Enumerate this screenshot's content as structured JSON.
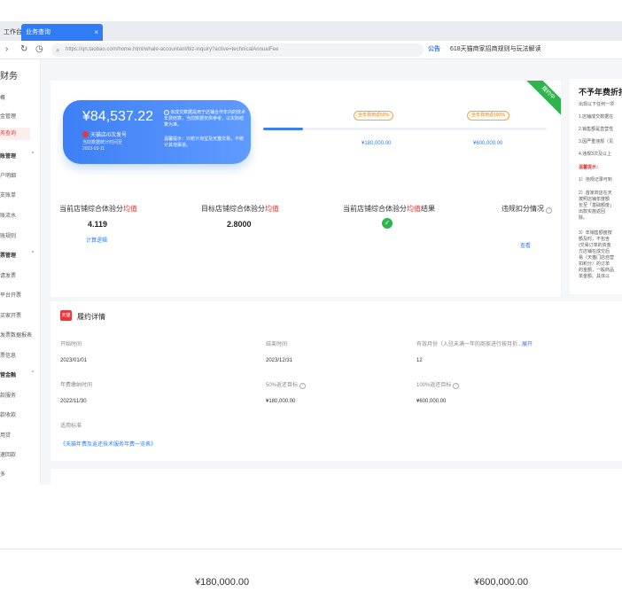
{
  "browser": {
    "tab_inactive": "工作台",
    "tab_active": "业务查询",
    "tab_close": "×",
    "url": "https://qn.taobao.com/home.html/whale-accountant/biz-inquiry?active=technicalAnnualFee",
    "notice_label": "公告",
    "notice_text": "618天猫商家招商规则与玩法解读"
  },
  "sidebar": {
    "title": "财务",
    "items": [
      {
        "label": "概",
        "active": false
      },
      {
        "label": "金管理",
        "active": false
      },
      {
        "label": "务查询",
        "active": true
      },
      {
        "label": "账管理",
        "active": false,
        "group": true,
        "arrow": "^"
      },
      {
        "label": "户明细",
        "active": false
      },
      {
        "label": "支账单",
        "active": false
      },
      {
        "label": "账流水",
        "active": false
      },
      {
        "label": "账规则",
        "active": false
      },
      {
        "label": "票管理",
        "active": false,
        "group": true,
        "arrow": "^"
      },
      {
        "label": "请发票",
        "active": false
      },
      {
        "label": "平台开票",
        "active": false
      },
      {
        "label": "买家开票",
        "active": false
      },
      {
        "label": "发票数据报表",
        "active": false
      },
      {
        "label": "票信息",
        "active": false
      },
      {
        "label": "营金融",
        "active": false,
        "group": true,
        "arrow": "^"
      },
      {
        "label": "款服务",
        "active": false
      },
      {
        "label": "款收款",
        "active": false
      },
      {
        "label": "用贷",
        "active": false
      },
      {
        "label": "速回款",
        "active": false
      },
      {
        "label": "多",
        "active": false
      }
    ]
  },
  "fee_card": {
    "amount": "¥84,537.22",
    "brand": "天猫店/0次发号",
    "date_caption": "当前数据统计时间至",
    "date": "2023-03-11",
    "desc": "该成交数据是用于店铺合作年内的技术年费结算，当前数据仅供参考，以实际结算为准。",
    "desc2": "温馨提示：只统计淘宝及天猫交易，不统计其他渠道。",
    "status_ribbon": "履约中",
    "milestones": [
      {
        "tag": "全年费用返50%",
        "value": "¥180,000.00"
      },
      {
        "tag": "全年费用返100%",
        "value": "¥600,000.00"
      }
    ],
    "progress_fraction": 0.14
  },
  "metrics": [
    {
      "label_pre": "当前店铺综合体验分",
      "label_hl": "均值",
      "value": "4.119",
      "link": "计算逻辑"
    },
    {
      "label_pre": "目标店铺综合体验分",
      "label_hl": "均值",
      "value": "2.8000",
      "link": ""
    },
    {
      "label_pre": "当前店铺综合体验分",
      "label_hl": "均值",
      "label_post": "结果",
      "value": "",
      "link": ""
    },
    {
      "label_pre": "违规扣分情况",
      "label_hl": "",
      "value": "",
      "link": "查看"
    }
  ],
  "details": {
    "title": "履约详情",
    "logo_text": "天猫",
    "fields": [
      {
        "label": "开始时间",
        "value": "2023/01/01"
      },
      {
        "label": "结束时间",
        "value": "2023/12/31"
      },
      {
        "label": "有效月份（入驻未满一年的商家进行按月折...",
        "link": "展开",
        "value": "12"
      },
      {
        "label": "年费缴纳时间",
        "value": "2022/11/30"
      },
      {
        "label": "50%返还目标",
        "value": "¥180,000.00"
      },
      {
        "label": "100%返还目标",
        "value": "¥600,000.00"
      },
      {
        "label": "适用标准",
        "value": "《天猫年费及返还技术服务年费一览表》"
      }
    ]
  },
  "right_panel": {
    "title": "不予年费折扣",
    "lines": [
      "出现以下任何一项",
      "1.店铺成交数据在",
      "2.销售额是直营性",
      "3.因严重违规（见",
      "4.违规3次及以上",
      "温馨提示：",
      "1）违规记录可到",
      "2）首家商店在天",
      "按照店铺年度额",
      "长至「基础额度」",
      "出款实施返回",
      "除。",
      "3）年销售额度按",
      "额及时，不包含",
      "(交易订单的资金",
      "方店铺在成交后",
      "易（天猫门店自营",
      "扣积分）的订单",
      "的金额，一般商品",
      "单金额。具体以"
    ]
  },
  "bottom": {
    "values": [
      "¥180,000.00",
      "¥600,000.00"
    ]
  },
  "colors": {
    "accent": "#2f7cf6",
    "red": "#e4393c",
    "green": "#2fb34c",
    "orange": "#e58a1b"
  }
}
